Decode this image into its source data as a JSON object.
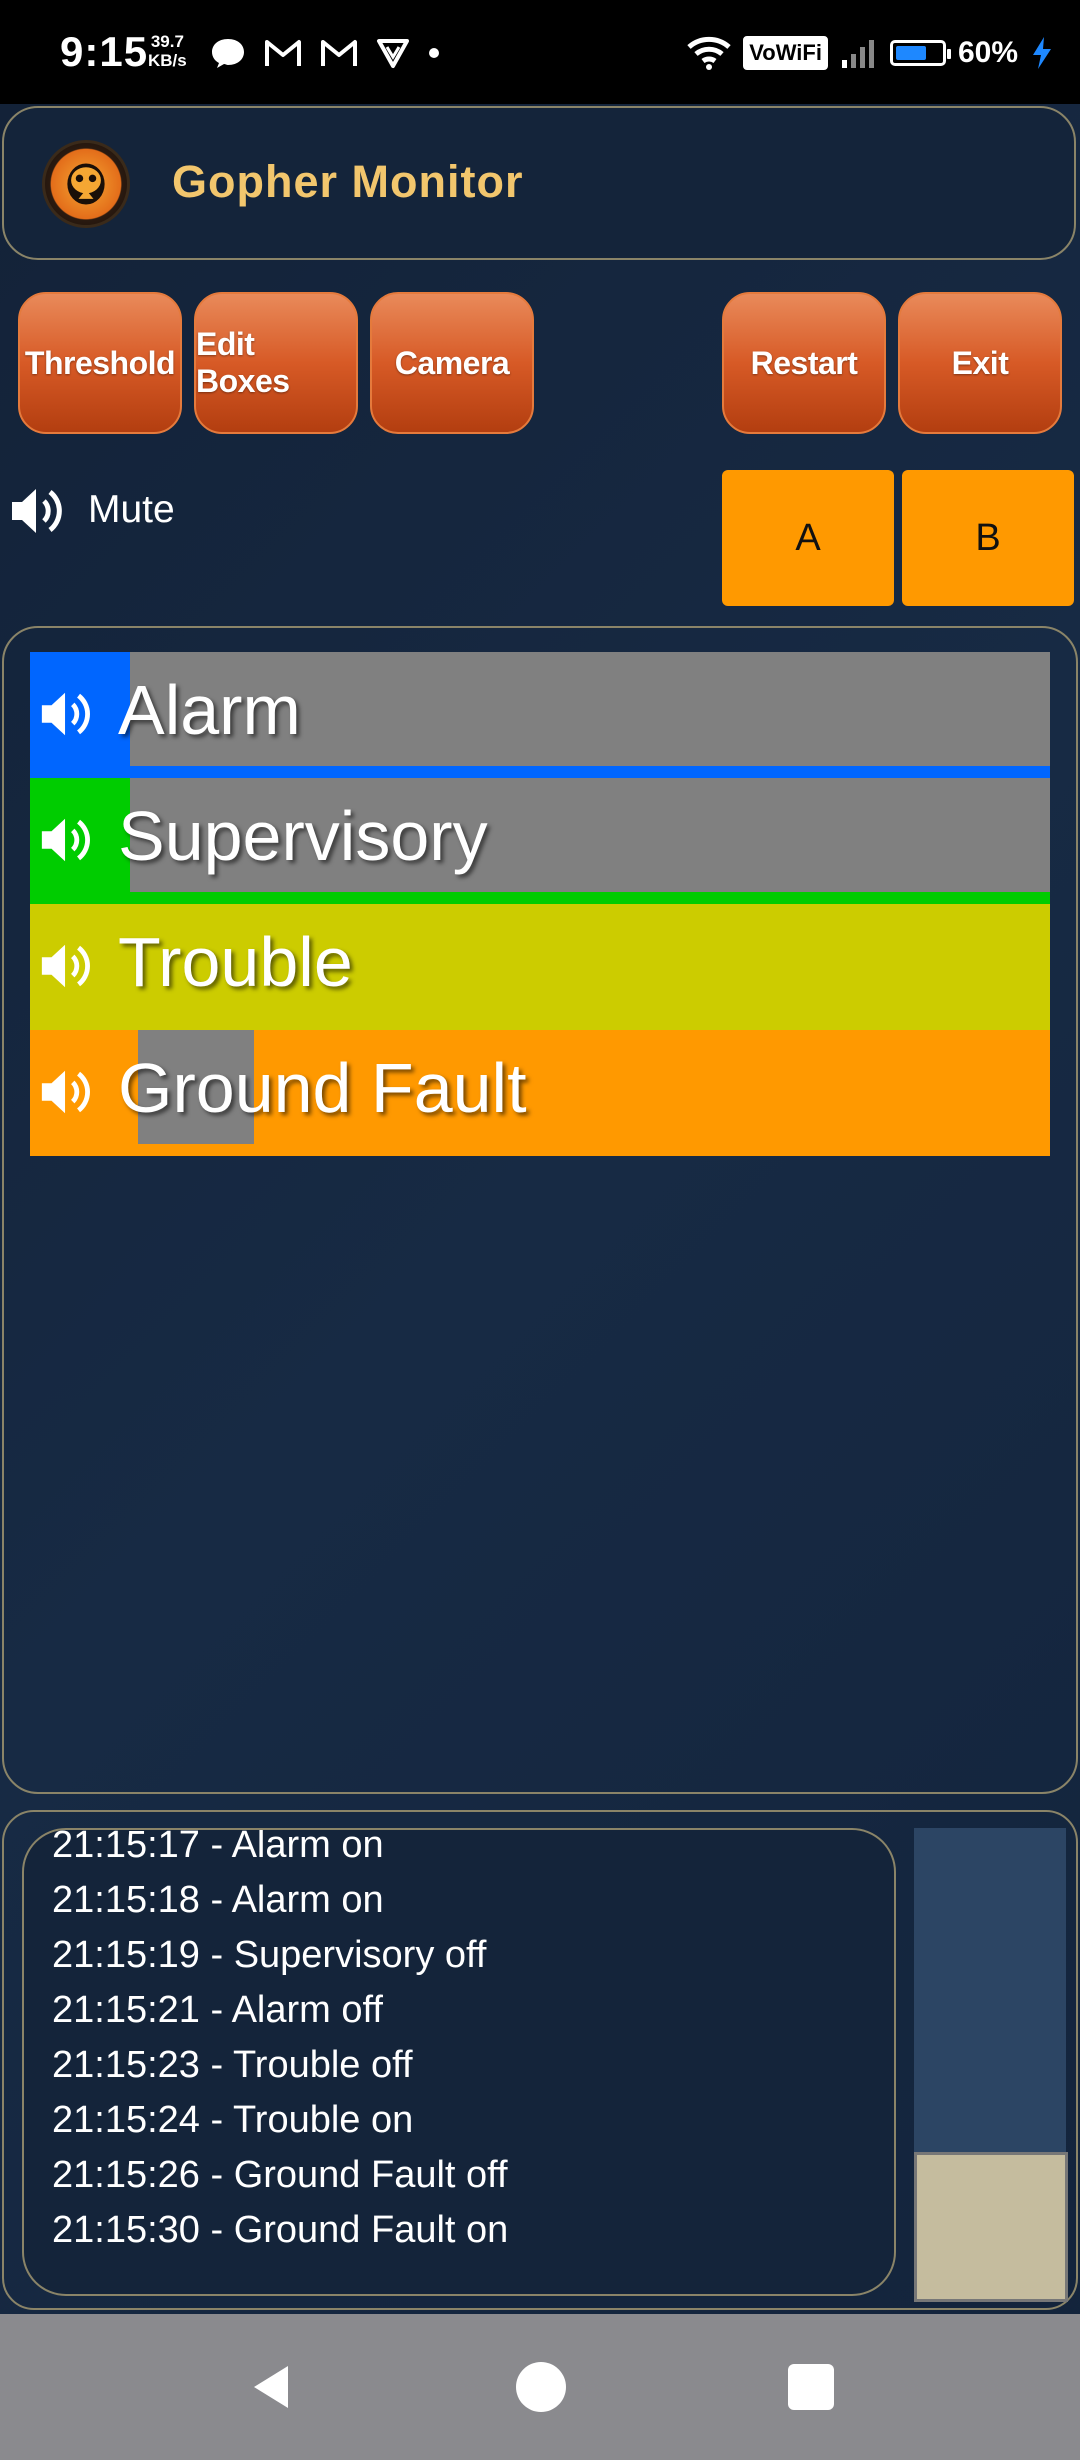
{
  "status_bar": {
    "time": "9:15",
    "speed_value": "39.7",
    "speed_unit": "KB/s",
    "vowifi_label": "VoWiFi",
    "battery_percent": "60%",
    "battery_level": 0.6,
    "icons_left": [
      "chat-bubble-icon",
      "gmail-icon",
      "gmail-icon",
      "vpn-icon",
      "dot-icon"
    ],
    "icons_right": [
      "wifi-icon",
      "vowifi-icon",
      "signal-icon",
      "battery-icon",
      "charging-icon"
    ]
  },
  "header": {
    "title": "Gopher Monitor",
    "logo_icon": "gopher-logo-icon"
  },
  "toolbar": {
    "threshold_label": "Threshold",
    "edit_boxes_label": "Edit Boxes",
    "camera_label": "Camera",
    "restart_label": "Restart",
    "exit_label": "Exit"
  },
  "mute": {
    "label": "Mute",
    "icon": "speaker-icon"
  },
  "channels": {
    "a_label": "A",
    "b_label": "B",
    "color": "#ff9900"
  },
  "alerts": [
    {
      "label": "Alarm",
      "color": "#0066ff",
      "bg": "#808080",
      "icon": "speaker-icon"
    },
    {
      "label": "Supervisory",
      "color": "#00cc00",
      "bg": "#808080",
      "icon": "speaker-icon"
    },
    {
      "label": "Trouble",
      "color": "#cccc00",
      "bg": "#cccc00",
      "icon": "speaker-icon"
    },
    {
      "label": "Ground Fault",
      "color": "#ff9900",
      "bg": "#ff9900",
      "icon": "speaker-icon"
    }
  ],
  "log": {
    "lines": [
      "21:15:17 - Alarm on",
      "21:15:18 - Alarm on",
      "21:15:19 - Supervisory off",
      "21:15:21 - Alarm off",
      "21:15:23 - Trouble off",
      "21:15:24 - Trouble on",
      "21:15:26 - Ground Fault off",
      "21:15:30 - Ground Fault on"
    ]
  },
  "nav": {
    "back_icon": "back-icon",
    "home_icon": "home-icon",
    "recents_icon": "recents-icon"
  }
}
